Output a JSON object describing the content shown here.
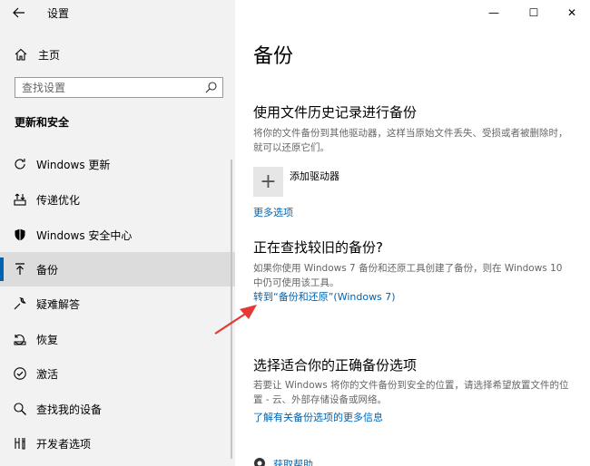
{
  "window": {
    "title": "设置",
    "controls": {
      "minimize": "—",
      "maximize": "☐",
      "close": "✕"
    }
  },
  "sidebar": {
    "home_label": "主页",
    "search_placeholder": "查找设置",
    "section_title": "更新和安全",
    "items": [
      {
        "label": "Windows 更新",
        "icon": "refresh-icon"
      },
      {
        "label": "传递优化",
        "icon": "delivery-optimization-icon"
      },
      {
        "label": "Windows 安全中心",
        "icon": "shield-icon"
      },
      {
        "label": "备份",
        "icon": "backup-icon",
        "active": true
      },
      {
        "label": "疑难解答",
        "icon": "wrench-icon"
      },
      {
        "label": "恢复",
        "icon": "recovery-icon"
      },
      {
        "label": "激活",
        "icon": "activation-check-icon"
      },
      {
        "label": "查找我的设备",
        "icon": "find-device-icon"
      },
      {
        "label": "开发者选项",
        "icon": "developer-icon"
      }
    ]
  },
  "main": {
    "page_title": "备份",
    "file_history": {
      "heading": "使用文件历史记录进行备份",
      "description": "将你的文件备份到其他驱动器，这样当原始文件丢失、受损或者被删除时，就可以还原它们。",
      "add_drive_label": "添加驱动器",
      "more_options_link": "更多选项"
    },
    "older_backup": {
      "heading": "正在查找较旧的备份?",
      "description": "如果你使用 Windows 7 备份和还原工具创建了备份，则在 Windows 10 中仍可使用该工具。",
      "link": "转到“备份和还原”(Windows 7)"
    },
    "choose_option": {
      "heading": "选择适合你的正确备份选项",
      "description": "若要让 Windows 将你的文件备份到安全的位置，请选择希望放置文件的位置 - 云、外部存储设备或网络。",
      "link": "了解有关备份选项的更多信息"
    },
    "help_link": "获取帮助"
  },
  "colors": {
    "accent": "#0063b1",
    "arrow": "#e53935",
    "sidebar_bg": "#f2f2f2"
  }
}
